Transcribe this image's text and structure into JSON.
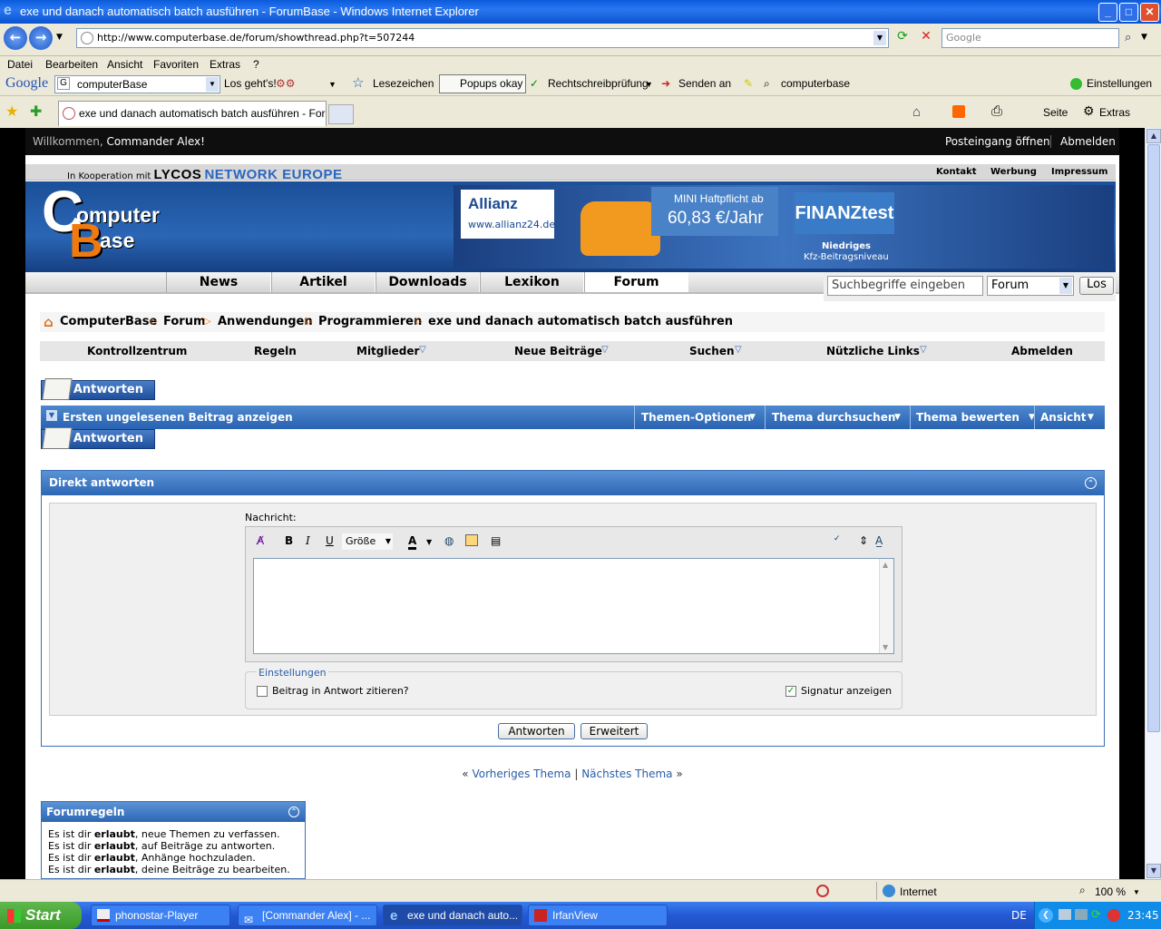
{
  "window": {
    "title": "exe und danach automatisch batch ausführen - ForumBase - Windows Internet Explorer"
  },
  "address": {
    "url": "http://www.computerbase.de/forum/showthread.php?t=507244",
    "search_placeholder": "Google"
  },
  "menu": [
    "Datei",
    "Bearbeiten",
    "Ansicht",
    "Favoriten",
    "Extras",
    "?"
  ],
  "gtoolbar": {
    "brand": "Google",
    "query": "computerBase",
    "go": "Los geht's!",
    "bookmarks": "Lesezeichen",
    "popups": "Popups okay",
    "spell": "Rechtschreibprüfung",
    "send": "Senden an",
    "cb": "computerbase",
    "settings": "Einstellungen"
  },
  "tabs": {
    "active": "exe und danach automatisch batch ausführen - Foru...",
    "page_menu": "Seite",
    "tools_menu": "Extras"
  },
  "site": {
    "welcome_prefix": "Willkommen,",
    "welcome_user": "Commander Alex!",
    "inbox": "Posteingang öffnen",
    "logout_top": "Abmelden",
    "koop_prefix": "In Kooperation mit",
    "koop_lycos": "LYCOS",
    "koop_network": "NETWORK EUROPE",
    "top_links": [
      "Kontakt",
      "Werbung",
      "Impressum"
    ],
    "logo_line1": "omputer",
    "logo_line2": "ase",
    "ad": {
      "brand": "Allianz",
      "url": "www.allianz24.de",
      "headline": "MINI Haftpflicht ab",
      "price": "60,83 €/Jahr",
      "test": "FINANZtest",
      "note1": "Niedriges",
      "note2": "Kfz-Beitragsniveau"
    },
    "nav": [
      "News",
      "Artikel",
      "Downloads",
      "Lexikon",
      "Forum"
    ],
    "search": {
      "placeholder": "Suchbegriffe eingeben",
      "scope": "Forum",
      "button": "Los"
    },
    "breadcrumb": [
      "ComputerBase",
      "Forum",
      "Anwendungen",
      "Programmieren",
      "exe und danach automatisch batch ausführen"
    ],
    "forumnav": [
      "Kontrollzentrum",
      "Regeln",
      "Mitglieder",
      "Neue Beiträge",
      "Suchen",
      "Nützliche Links",
      "Abmelden"
    ],
    "reply_button": "Antworten",
    "thread_toolbar": {
      "first_unread": "Ersten ungelesenen Beitrag anzeigen",
      "options": "Themen-Optionen",
      "search": "Thema durchsuchen",
      "rate": "Thema bewerten",
      "view": "Ansicht"
    },
    "quick_reply": {
      "title": "Direkt antworten",
      "message_label": "Nachricht:",
      "size": "Größe",
      "settings_legend": "Einstellungen",
      "quote_label": "Beitrag in Antwort zitieren?",
      "signature_label": "Signatur anzeigen",
      "submit": "Antworten",
      "advanced": "Erweitert"
    },
    "prev_thread": "Vorheriges Thema",
    "next_thread": "Nächstes Thema",
    "rules": {
      "title": "Forumregeln",
      "lines": [
        {
          "a": "Es ist dir ",
          "b": "erlaubt",
          "c": ", neue Themen zu verfassen."
        },
        {
          "a": "Es ist dir ",
          "b": "erlaubt",
          "c": ", auf Beiträge zu antworten."
        },
        {
          "a": "Es ist dir ",
          "b": "erlaubt",
          "c": ", Anhänge hochzuladen."
        },
        {
          "a": "Es ist dir ",
          "b": "erlaubt",
          "c": ", deine Beiträge zu bearbeiten."
        }
      ]
    }
  },
  "status": {
    "zone": "Internet",
    "zoom": "100 %"
  },
  "taskbar": {
    "start": "Start",
    "tasks": [
      "phonostar-Player",
      "[Commander Alex] - ...",
      "exe und danach auto...",
      "IrfanView"
    ],
    "lang": "DE",
    "clock": "23:45"
  }
}
